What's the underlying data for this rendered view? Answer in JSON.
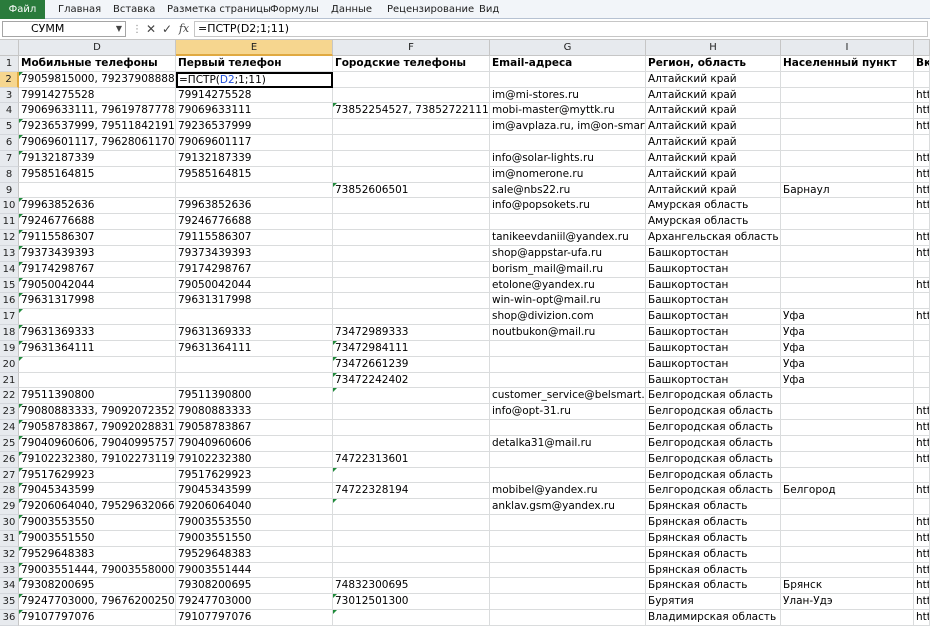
{
  "ribbon": {
    "file": "Файл",
    "tabs": [
      "Главная",
      "Вставка",
      "Разметка страницы",
      "Формулы",
      "Данные",
      "Рецензирование",
      "Вид"
    ]
  },
  "formula_bar": {
    "name_box": "СУММ",
    "cancel_icon": "✕",
    "enter_icon": "✓",
    "fx": "fx",
    "formula": "=ПСТР(D2;1;11)"
  },
  "columns": [
    "D",
    "E",
    "F",
    "G",
    "H",
    "I",
    ""
  ],
  "headers": [
    "Мобильные телефоны",
    "Первый телефон",
    "Городские телефоны",
    "Email-адреса",
    "Регион, область",
    "Населенный пункт",
    "Вк"
  ],
  "active_cell": {
    "before": "=ПСТР(",
    "ref": "D2",
    "after": ";1;11)"
  },
  "rows": [
    {
      "n": "2",
      "c": [
        "79059815000, 79237908888, 7923",
        "",
        "",
        "",
        "Алтайский край",
        "",
        ""
      ]
    },
    {
      "n": "3",
      "c": [
        "79914275528",
        "79914275528",
        "",
        "im@mi-stores.ru",
        "Алтайский край",
        "",
        "htt"
      ]
    },
    {
      "n": "4",
      "c": [
        "79069633111, 79619787778, 7962",
        "79069633111",
        "73852254527, 73852722111",
        "mobi-master@myttk.ru",
        "Алтайский край",
        "",
        "htt"
      ]
    },
    {
      "n": "5",
      "c": [
        "79236537999, 79511842191",
        "79236537999",
        "",
        "im@avplaza.ru, im@on-smart.ru",
        "Алтайский край",
        "",
        "htt"
      ]
    },
    {
      "n": "6",
      "c": [
        "79069601117, 79628061170",
        "79069601117",
        "",
        "",
        "Алтайский край",
        "",
        ""
      ]
    },
    {
      "n": "7",
      "c": [
        "79132187339",
        "79132187339",
        "",
        "info@solar-lights.ru",
        "Алтайский край",
        "",
        "htt"
      ]
    },
    {
      "n": "8",
      "c": [
        "79585164815",
        "79585164815",
        "",
        "im@nomerone.ru",
        "Алтайский край",
        "",
        "htt"
      ]
    },
    {
      "n": "9",
      "c": [
        "",
        "",
        "73852606501",
        "sale@nbs22.ru",
        "Алтайский край",
        "Барнаул",
        "htt"
      ]
    },
    {
      "n": "10",
      "c": [
        "79963852636",
        "79963852636",
        "",
        "info@popsokets.ru",
        "Амурская область",
        "",
        "htt"
      ]
    },
    {
      "n": "11",
      "c": [
        "79246776688",
        "79246776688",
        "",
        "",
        "Амурская область",
        "",
        ""
      ]
    },
    {
      "n": "12",
      "c": [
        "79115586307",
        "79115586307",
        "",
        "tanikeevdaniil@yandex.ru",
        "Архангельская область",
        "",
        "htt"
      ]
    },
    {
      "n": "13",
      "c": [
        "79373439393",
        "79373439393",
        "",
        "shop@appstar-ufa.ru",
        "Башкортостан",
        "",
        "htt"
      ]
    },
    {
      "n": "14",
      "c": [
        "79174298767",
        "79174298767",
        "",
        "borism_mail@mail.ru",
        "Башкортостан",
        "",
        ""
      ]
    },
    {
      "n": "15",
      "c": [
        "79050042044",
        "79050042044",
        "",
        "etolone@yandex.ru",
        "Башкортостан",
        "",
        "htt"
      ]
    },
    {
      "n": "16",
      "c": [
        "79631317998",
        "79631317998",
        "",
        "win-win-opt@mail.ru",
        "Башкортостан",
        "",
        ""
      ]
    },
    {
      "n": "17",
      "c": [
        "",
        "",
        "",
        "shop@divizion.com",
        "Башкортостан",
        "Уфа",
        "htt"
      ]
    },
    {
      "n": "18",
      "c": [
        "79631369333",
        "79631369333",
        "73472989333",
        "noutbukon@mail.ru",
        "Башкортостан",
        "Уфа",
        ""
      ]
    },
    {
      "n": "19",
      "c": [
        "79631364111",
        "79631364111",
        "73472984111",
        "",
        "Башкортостан",
        "Уфа",
        ""
      ]
    },
    {
      "n": "20",
      "c": [
        "",
        "",
        "73472661239",
        "",
        "Башкортостан",
        "Уфа",
        ""
      ]
    },
    {
      "n": "21",
      "c": [
        "",
        "",
        "73472242402",
        "",
        "Башкортостан",
        "Уфа",
        ""
      ]
    },
    {
      "n": "22",
      "c": [
        "79511390800",
        "79511390800",
        "",
        "customer_service@belsmart.ru",
        "Белгородская область",
        "",
        ""
      ]
    },
    {
      "n": "23",
      "c": [
        "79080883333, 79092072352",
        "79080883333",
        "",
        "info@opt-31.ru",
        "Белгородская область",
        "",
        "htt"
      ]
    },
    {
      "n": "24",
      "c": [
        "79058783867, 79092028831, 7909",
        "79058783867",
        "",
        "",
        "Белгородская область",
        "",
        "htt"
      ]
    },
    {
      "n": "25",
      "c": [
        "79040960606, 79040995757",
        "79040960606",
        "",
        "detalka31@mail.ru",
        "Белгородская область",
        "",
        "htt"
      ]
    },
    {
      "n": "26",
      "c": [
        "79102232380, 79102273119",
        "79102232380",
        "74722313601",
        "",
        "Белгородская область",
        "",
        "htt"
      ]
    },
    {
      "n": "27",
      "c": [
        "79517629923",
        "79517629923",
        "",
        "",
        "Белгородская область",
        "",
        ""
      ]
    },
    {
      "n": "28",
      "c": [
        "79045343599",
        "79045343599",
        "74722328194",
        "mobibel@yandex.ru",
        "Белгородская область",
        "Белгород",
        "htt"
      ]
    },
    {
      "n": "29",
      "c": [
        "79206064040, 79529632066",
        "79206064040",
        "",
        "anklav.gsm@yandex.ru",
        "Брянская область",
        "",
        ""
      ]
    },
    {
      "n": "30",
      "c": [
        "79003553550",
        "79003553550",
        "",
        "",
        "Брянская область",
        "",
        "htt"
      ]
    },
    {
      "n": "31",
      "c": [
        "79003551550",
        "79003551550",
        "",
        "",
        "Брянская область",
        "",
        "htt"
      ]
    },
    {
      "n": "32",
      "c": [
        "79529648383",
        "79529648383",
        "",
        "",
        "Брянская область",
        "",
        "htt"
      ]
    },
    {
      "n": "33",
      "c": [
        "79003551444, 79003558000",
        "79003551444",
        "",
        "",
        "Брянская область",
        "",
        "htt"
      ]
    },
    {
      "n": "34",
      "c": [
        "79308200695",
        "79308200695",
        "74832300695",
        "",
        "Брянская область",
        "Брянск",
        "htt"
      ]
    },
    {
      "n": "35",
      "c": [
        "79247703000, 79676200250",
        "79247703000",
        "73012501300",
        "",
        "Бурятия",
        "Улан-Удэ",
        "htt"
      ]
    },
    {
      "n": "36",
      "c": [
        "79107797076",
        "79107797076",
        "",
        "",
        "Владимирская область",
        "",
        "htt"
      ]
    }
  ]
}
